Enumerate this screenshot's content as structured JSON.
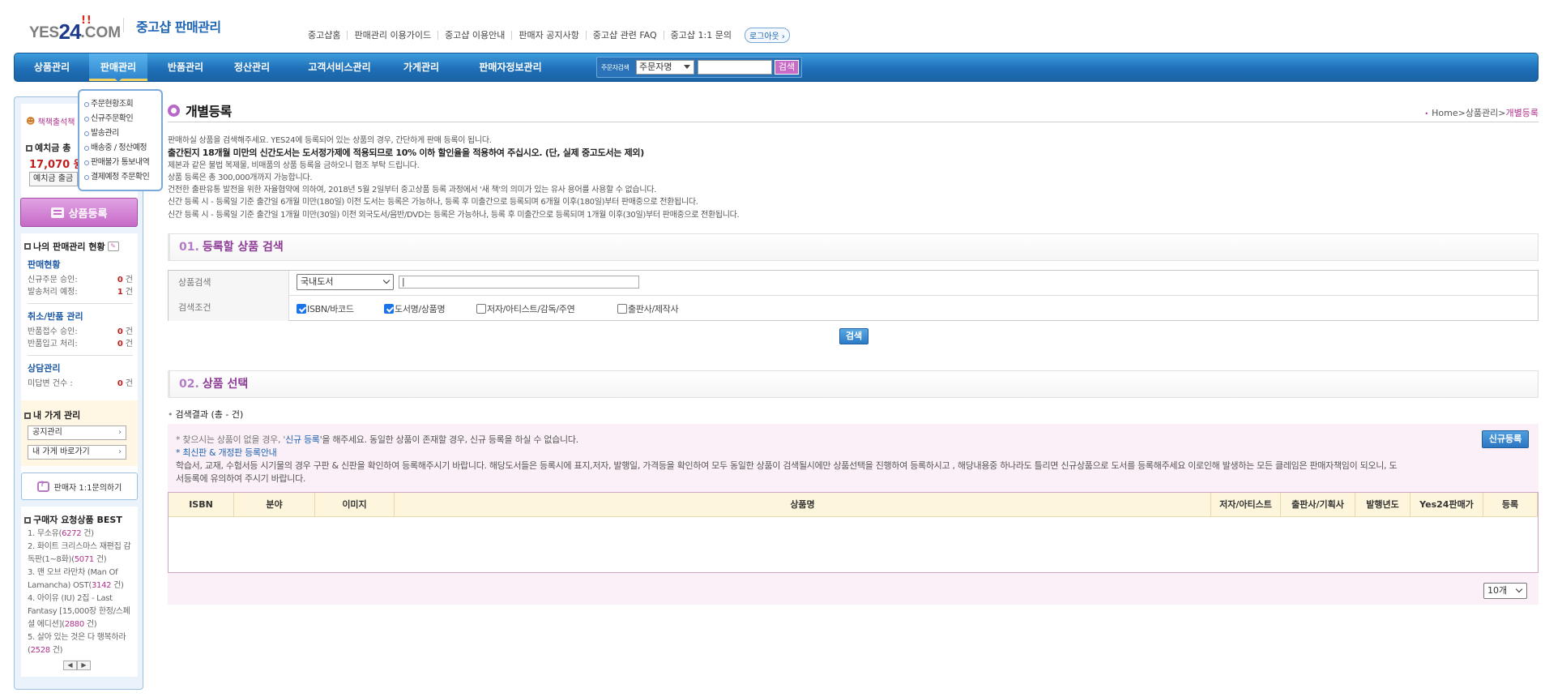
{
  "header": {
    "logo_yes": "YES",
    "logo_24": "24",
    "logo_com": ".COM",
    "brand_title": "중고샵 판매관리",
    "top_links": [
      "중고샵홈",
      "판매관리 이용가이드",
      "중고샵 이용안내",
      "판매자 공지사항",
      "중고샵 관련 FAQ",
      "중고샵 1:1 문의"
    ],
    "logout_label": "로그아웃 ›"
  },
  "nav": {
    "items": [
      "상품관리",
      "판매관리",
      "반품관리",
      "정산관리",
      "고객서비스관리",
      "가게관리",
      "판매자정보관리"
    ],
    "active_index": 1,
    "order_search": {
      "label": "주문자검색",
      "select_value": "주문자명",
      "button_label": "검색"
    }
  },
  "dropdown": {
    "items": [
      "주문현황조회",
      "신규주문확인",
      "발송관리",
      "배송중 / 정산예정",
      "판매불가 통보내역",
      "결제예정 주문확인"
    ]
  },
  "sidebar": {
    "seller_label": "책책출석책",
    "deposit_label": "예치금 총",
    "deposit_value": "17,070 원",
    "deposit_button": "예치금 출금",
    "register_button": "상품등록",
    "status_title": "나의 판매관리 현황",
    "groups": [
      {
        "title": "판매현황",
        "rows": [
          {
            "label": "신규주문 승인:",
            "value": "0",
            "unit": "건"
          },
          {
            "label": "발송처리 예정:",
            "value": "1",
            "unit": "건"
          }
        ]
      },
      {
        "title": "취소/반품 관리",
        "rows": [
          {
            "label": "반품접수 승인:",
            "value": "0",
            "unit": "건"
          },
          {
            "label": "반품입고 처리:",
            "value": "0",
            "unit": "건"
          }
        ]
      },
      {
        "title": "상담관리",
        "rows": [
          {
            "label": "미답변 건수 :",
            "value": "0",
            "unit": "건"
          }
        ]
      }
    ],
    "store_title": "내 가게 관리",
    "store_buttons": [
      "공지관리",
      "내 가게 바로가기"
    ],
    "inquiry_button": "판매자 1:1문의하기",
    "best_title": "구매자 요청상품 BEST",
    "best_items": [
      {
        "text": "1. 무소유(",
        "count": "6272",
        "suffix": " 건)"
      },
      {
        "text": "2. 화이트 크리스마스 재편집 감독판(1~8화)(",
        "count": "5071",
        "suffix": " 건)"
      },
      {
        "text": "3. 맨 오브 라만차 (Man Of Lamancha) OST(",
        "count": "3142",
        "suffix": " 건)"
      },
      {
        "text": "4. 아이유 (IU) 2집 - Last Fantasy [15,000장 한정/스페셜 에디션](",
        "count": "2880",
        "suffix": " 건)"
      },
      {
        "text": "5. 살아 있는 것은 다 행복하라(",
        "count": "2528",
        "suffix": " 건)"
      }
    ],
    "pager_prev": "◀",
    "pager_next": "▶"
  },
  "content": {
    "page_title": "개별등록",
    "breadcrumb": {
      "home": "Home",
      "parent": "상품관리",
      "current": "개별등록"
    },
    "notice_lines": [
      "판매하실 상품을 검색해주세요. YES24에 등록되어 있는 상품의 경우, 간단하게 판매 등록이 됩니다.",
      "출간된지 18개월 미만의 신간도서는 도서정가제에 적용되므로 10% 이하 할인율을 적용하여 주십시오. (단, 실제 중고도서는 제외)",
      "제본과 같은 불법 복제물, 비매품의 상품 등록을 금하오니 협조 부탁 드립니다.",
      "상품 등록은 총 300,000개까지 가능합니다.",
      "건전한 출판유통 발전을 위한 자율협약에 의하여, 2018년 5월 2일부터 중고상품 등록 과정에서 '새 책'의 의미가 있는 유사 용어를 사용할 수 없습니다.",
      "신간 등록 시 - 등록일 기준 출간일 6개월 미만(180일) 이전 도서는 등록은 가능하나, 등록 후 미출간으로 등록되며 6개월 이후(180일)부터 판매중으로 전환됩니다.",
      "신간 등록 시 - 등록일 기준 출간일 1개월 미만(30일) 이전 외국도서/음반/DVD는 등록은 가능하나, 등록 후 미출간으로 등록되며 1개월 이후(30일)부터 판매중으로 전환됩니다."
    ],
    "section1": {
      "num": "01.",
      "title": "등록할 상품 검색"
    },
    "search": {
      "product_label": "상품검색",
      "category_value": "국내도서",
      "keyword_value": "|",
      "condition_label": "검색조건",
      "options": [
        {
          "label": "ISBN/바코드",
          "checked": true
        },
        {
          "label": "도서명/상품명",
          "checked": true
        },
        {
          "label": "저자/아티스트/감독/주연",
          "checked": false
        },
        {
          "label": "출판사/제작사",
          "checked": false
        }
      ],
      "button_label": "검색"
    },
    "section2": {
      "num": "02.",
      "title": "상품 선택"
    },
    "result_label": "검색결과 (총 - 건)",
    "result": {
      "line1_pre": "* 찾으시는 상품이 없을 경우, '",
      "line1_link": "신규 등록",
      "line1_post": "'을 해주세요. 동일한 상품이 존재할 경우, 신규 등록을 하실 수 없습니다.",
      "line2_link": "* 최신판 & 개정판 등록안내",
      "line3": "학습서, 교재, 수험서등 시기물의 경우 구판 & 신판을 확인하여 등록해주시기 바랍니다. 해당도서들은 등록시에 표지,저자, 발행일, 가격등을 확인하여 모두 동일한 상품이 검색될시에만 상품선택을 진행하여 등록하시고 , 해당내용중 하나라도 틀리면 신규상품으로 도서를 등록해주세요 이로인해 발생하는 모든 클레임은 판매자책임이 되오니, 도",
      "line4": "서등록에 유의하여 주시기 바랍니다.",
      "new_button": "신규등록",
      "columns": [
        "ISBN",
        "분야",
        "이미지",
        "상품명",
        "저자/아티스트",
        "출판사/기획사",
        "발행년도",
        "Yes24판매가",
        "등록"
      ],
      "page_size": "10개"
    }
  }
}
